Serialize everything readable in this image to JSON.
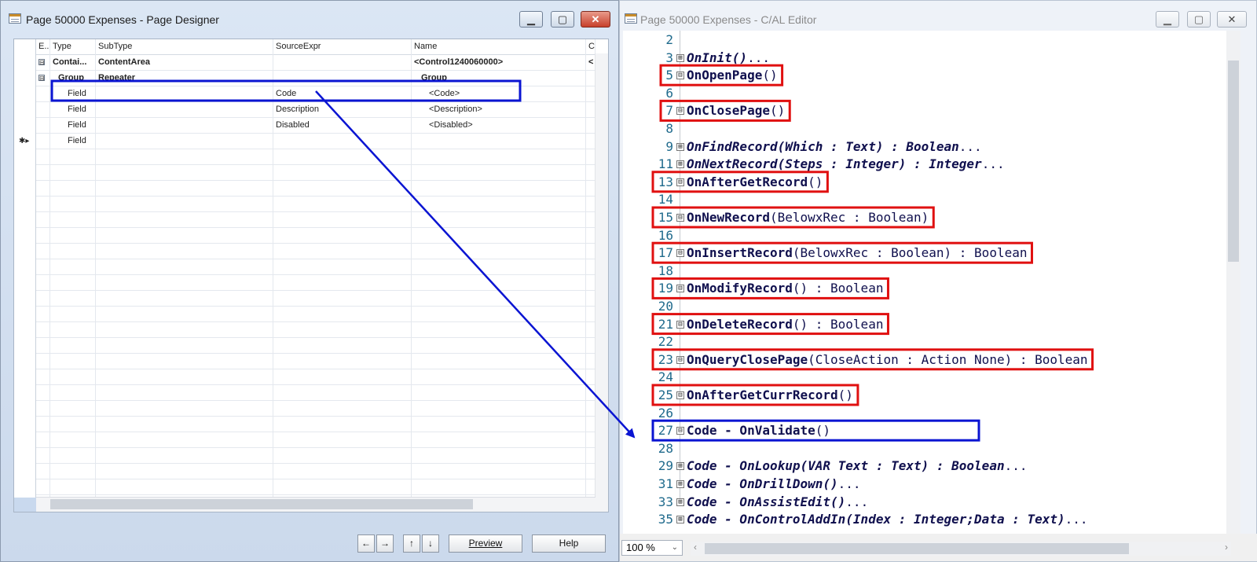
{
  "designer": {
    "title": "Page 50000 Expenses - Page Designer",
    "columns": [
      "E...",
      "Type",
      "SubType",
      "SourceExpr",
      "Name",
      "C"
    ],
    "rows": [
      {
        "toggle": "⊟",
        "type": "Contai...",
        "subtype": "ContentArea",
        "source": "",
        "name": "<Control1240060000>",
        "extra": "<"
      },
      {
        "toggle": "⊟",
        "type": "Group",
        "subtype": "Repeater",
        "source": "",
        "name": "Group",
        "extra": ""
      },
      {
        "toggle": "",
        "type": "Field",
        "subtype": "",
        "source": "Code",
        "name": "<Code>",
        "extra": ""
      },
      {
        "toggle": "",
        "type": "Field",
        "subtype": "",
        "source": "Description",
        "name": "<Description>",
        "extra": ""
      },
      {
        "toggle": "",
        "type": "Field",
        "subtype": "",
        "source": "Disabled",
        "name": "<Disabled>",
        "extra": ""
      },
      {
        "toggle": "",
        "type": "Field",
        "subtype": "",
        "source": "",
        "name": "",
        "extra": "",
        "marker": "✱▸"
      }
    ],
    "buttons": {
      "left": "←",
      "right": "→",
      "up": "↑",
      "down": "↓",
      "preview": "Preview",
      "help": "Help"
    }
  },
  "editor": {
    "title": "Page 50000 Expenses - C/AL Editor",
    "zoom": "100 %",
    "lines": [
      {
        "num": "2",
        "toggle": "",
        "name": "",
        "rest": ""
      },
      {
        "num": "3",
        "toggle": "⊞",
        "name": "OnInit()",
        "rest": "...",
        "style": "italic"
      },
      {
        "num": "5",
        "toggle": "⊟",
        "name": "OnOpenPage",
        "rest": "()"
      },
      {
        "num": "6",
        "toggle": "",
        "name": "",
        "rest": ""
      },
      {
        "num": "7",
        "toggle": "⊟",
        "name": "OnClosePage",
        "rest": "()"
      },
      {
        "num": "8",
        "toggle": "",
        "name": "",
        "rest": ""
      },
      {
        "num": "9",
        "toggle": "⊞",
        "name": "OnFindRecord(Which : Text) : Boolean",
        "rest": "...",
        "style": "italic"
      },
      {
        "num": "11",
        "toggle": "⊞",
        "name": "OnNextRecord(Steps : Integer) : Integer",
        "rest": "...",
        "style": "italic"
      },
      {
        "num": "13",
        "toggle": "⊟",
        "name": "OnAfterGetRecord",
        "rest": "()"
      },
      {
        "num": "14",
        "toggle": "",
        "name": "",
        "rest": ""
      },
      {
        "num": "15",
        "toggle": "⊟",
        "name": "OnNewRecord",
        "rest": "(BelowxRec : Boolean)"
      },
      {
        "num": "16",
        "toggle": "",
        "name": "",
        "rest": ""
      },
      {
        "num": "17",
        "toggle": "⊟",
        "name": "OnInsertRecord",
        "rest": "(BelowxRec : Boolean) : Boolean"
      },
      {
        "num": "18",
        "toggle": "",
        "name": "",
        "rest": ""
      },
      {
        "num": "19",
        "toggle": "⊟",
        "name": "OnModifyRecord",
        "rest": "() : Boolean"
      },
      {
        "num": "20",
        "toggle": "",
        "name": "",
        "rest": ""
      },
      {
        "num": "21",
        "toggle": "⊟",
        "name": "OnDeleteRecord",
        "rest": "() : Boolean"
      },
      {
        "num": "22",
        "toggle": "",
        "name": "",
        "rest": ""
      },
      {
        "num": "23",
        "toggle": "⊟",
        "name": "OnQueryClosePage",
        "rest": "(CloseAction : Action None) : Boolean"
      },
      {
        "num": "24",
        "toggle": "",
        "name": "",
        "rest": ""
      },
      {
        "num": "25",
        "toggle": "⊟",
        "name": "OnAfterGetCurrRecord",
        "rest": "()"
      },
      {
        "num": "26",
        "toggle": "",
        "name": "",
        "rest": ""
      },
      {
        "num": "27",
        "toggle": "⊟",
        "name": "Code - OnValidate",
        "rest": "()"
      },
      {
        "num": "28",
        "toggle": "",
        "name": "",
        "rest": ""
      },
      {
        "num": "29",
        "toggle": "⊞",
        "name": "Code - OnLookup(VAR Text : Text) : Boolean",
        "rest": "...",
        "style": "italic"
      },
      {
        "num": "31",
        "toggle": "⊞",
        "name": "Code - OnDrillDown()",
        "rest": "...",
        "style": "italic"
      },
      {
        "num": "33",
        "toggle": "⊞",
        "name": "Code - OnAssistEdit()",
        "rest": "...",
        "style": "italic"
      },
      {
        "num": "35",
        "toggle": "⊞",
        "name": "Code - OnControlAddIn(Index : Integer;Data : Text)",
        "rest": "...",
        "style": "italic"
      }
    ]
  },
  "annotation_colors": {
    "highlight_red": "#e01010",
    "highlight_blue": "#0a14d2"
  },
  "icons": [
    "window-icon",
    "minimize-icon",
    "maximize-icon",
    "close-icon",
    "arrow-left-icon",
    "arrow-right-icon",
    "arrow-up-icon",
    "arrow-down-icon",
    "expand-icon",
    "collapse-icon"
  ]
}
